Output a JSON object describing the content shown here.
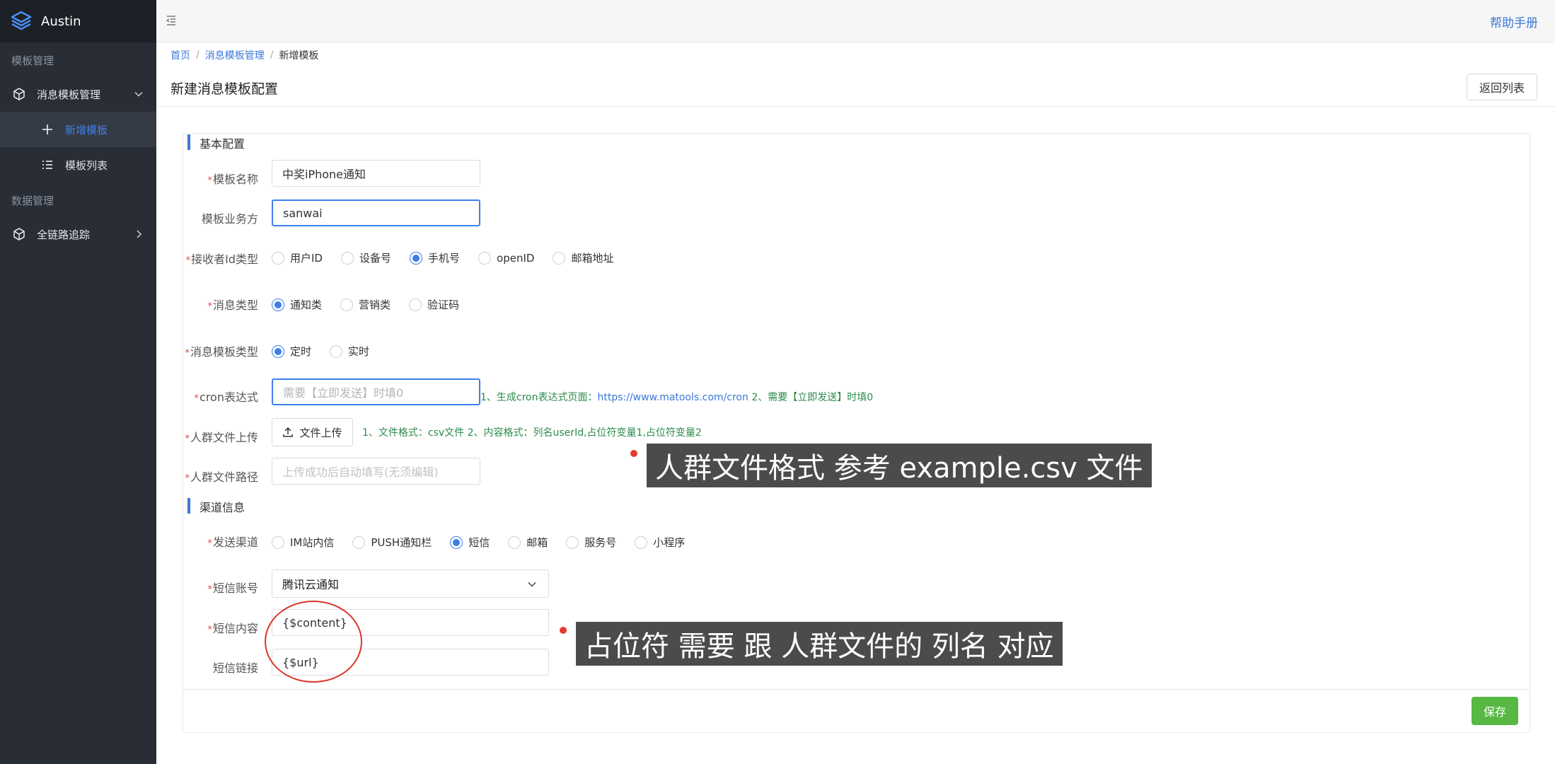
{
  "app": {
    "name": "Austin"
  },
  "sidebar": {
    "section1": "模板管理",
    "menu1": "消息模板管理",
    "sub_new": "新增模板",
    "sub_list": "模板列表",
    "section2": "数据管理",
    "menu2": "全链路追踪"
  },
  "header": {
    "help": "帮助手册"
  },
  "breadcrumb": {
    "home": "首页",
    "parent": "消息模板管理",
    "current": "新增模板"
  },
  "page": {
    "title": "新建消息模板配置",
    "back_button": "返回列表"
  },
  "form": {
    "basic_section": "基本配置",
    "template_name": {
      "label": "模板名称",
      "value": "中奖iPhone通知"
    },
    "business": {
      "label": "模板业务方",
      "value": "sanwai"
    },
    "receiver_id_type": {
      "label": "接收者Id类型",
      "options": [
        "用户ID",
        "设备号",
        "手机号",
        "openID",
        "邮箱地址"
      ],
      "selected": "手机号"
    },
    "msg_type": {
      "label": "消息类型",
      "options": [
        "通知类",
        "营销类",
        "验证码"
      ],
      "selected": "通知类"
    },
    "template_type": {
      "label": "消息模板类型",
      "options": [
        "定时",
        "实时"
      ],
      "selected": "定时"
    },
    "cron": {
      "label": "cron表达式",
      "placeholder": "需要【立即发送】时填0",
      "hint_prefix": "1、生成cron表达式页面：",
      "hint_link": "https://www.matools.com/cron",
      "hint_suffix": " 2、需要【立即发送】时填0"
    },
    "crowd_upload": {
      "label": "人群文件上传",
      "button": "文件上传",
      "hint": "1、文件格式：csv文件 2、内容格式：列名userId,占位符变量1,占位符变量2"
    },
    "crowd_path": {
      "label": "人群文件路径",
      "placeholder": "上传成功后自动填写(无须编辑)"
    },
    "channel_section": "渠道信息",
    "send_channel": {
      "label": "发送渠道",
      "options": [
        "IM站内信",
        "PUSH通知栏",
        "短信",
        "邮箱",
        "服务号",
        "小程序"
      ],
      "selected": "短信"
    },
    "sms_account": {
      "label": "短信账号",
      "value": "腾讯云通知"
    },
    "sms_content": {
      "label": "短信内容",
      "value": "{$content}"
    },
    "sms_url": {
      "label": "短信链接",
      "value": "{$url}"
    },
    "save_button": "保存"
  },
  "annotations": {
    "caption1": "人群文件格式 参考 example.csv 文件",
    "caption2": "占位符 需要 跟 人群文件的 列名 对应"
  },
  "colors": {
    "accent": "#3d7fe6",
    "save": "#57b843",
    "sidebar": "#282d36",
    "hint": "#2c8a4a"
  }
}
